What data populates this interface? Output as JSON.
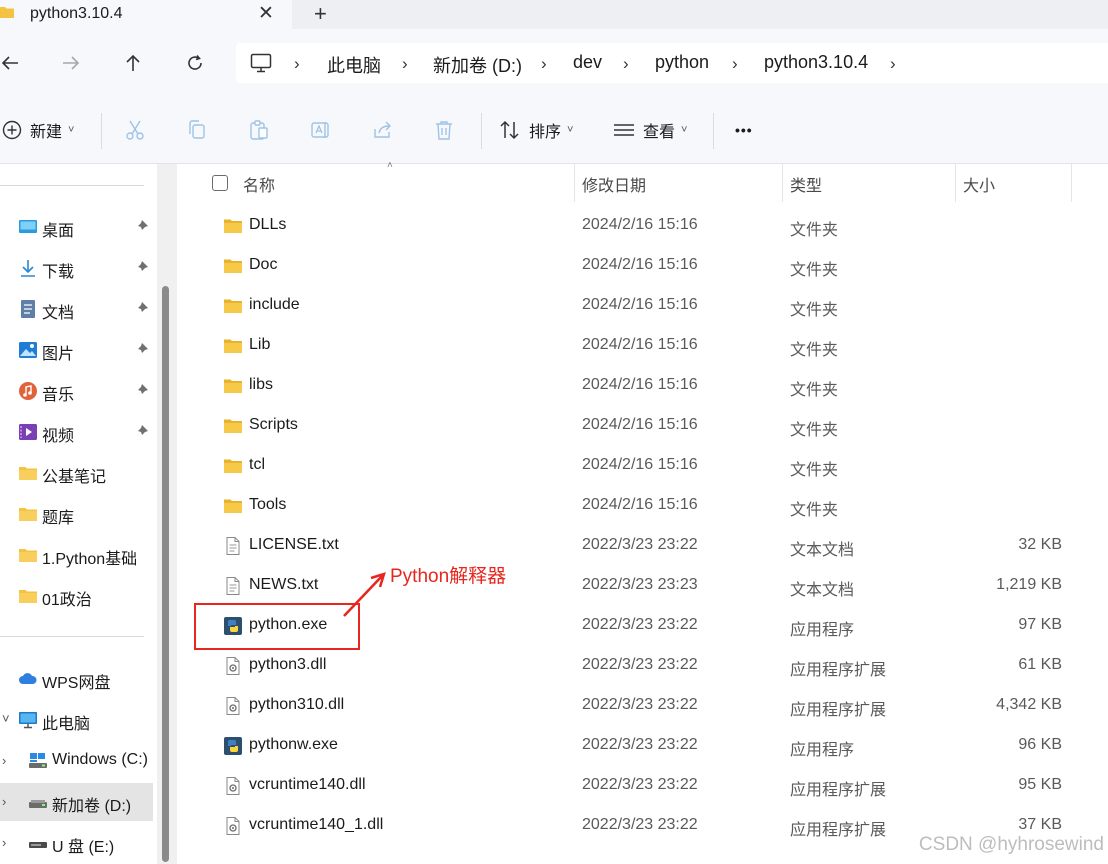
{
  "tab": {
    "title": "python3.10.4",
    "close_glyph": "✕",
    "new_glyph": "+"
  },
  "address": {
    "root_icon": "computer-icon",
    "crumbs": [
      "此电脑",
      "新加卷 (D:)",
      "dev",
      "python",
      "python3.10.4"
    ]
  },
  "toolbar": {
    "new_label": "新建",
    "sort_label": "排序",
    "view_label": "查看",
    "more_label": "•••"
  },
  "sidebar": {
    "quick_access": [
      {
        "label": "桌面",
        "icon": "desktop-icon",
        "pinned": true
      },
      {
        "label": "下载",
        "icon": "download-icon",
        "pinned": true
      },
      {
        "label": "文档",
        "icon": "documents-icon",
        "pinned": true
      },
      {
        "label": "图片",
        "icon": "pictures-icon",
        "pinned": true
      },
      {
        "label": "音乐",
        "icon": "music-icon",
        "pinned": true
      },
      {
        "label": "视频",
        "icon": "videos-icon",
        "pinned": true
      },
      {
        "label": "公基笔记",
        "icon": "folder-icon",
        "pinned": false
      },
      {
        "label": "题库",
        "icon": "folder-icon",
        "pinned": false
      },
      {
        "label": "1.Python基础",
        "icon": "folder-icon",
        "pinned": false
      },
      {
        "label": "01政治",
        "icon": "folder-icon",
        "pinned": false
      }
    ],
    "locations": [
      {
        "label": "WPS网盘",
        "icon": "cloud-icon"
      },
      {
        "label": "此电脑",
        "icon": "computer-icon"
      },
      {
        "label": "Windows (C:)",
        "icon": "windows-drive-icon"
      },
      {
        "label": "新加卷 (D:)",
        "icon": "drive-icon",
        "selected": true
      },
      {
        "label": "U 盘 (E:)",
        "icon": "usb-drive-icon"
      }
    ]
  },
  "columns": {
    "name": "名称",
    "date": "修改日期",
    "type": "类型",
    "size": "大小"
  },
  "files": [
    {
      "name": "DLLs",
      "date": "2024/2/16 15:16",
      "type": "文件夹",
      "size": "",
      "icon": "folder"
    },
    {
      "name": "Doc",
      "date": "2024/2/16 15:16",
      "type": "文件夹",
      "size": "",
      "icon": "folder"
    },
    {
      "name": "include",
      "date": "2024/2/16 15:16",
      "type": "文件夹",
      "size": "",
      "icon": "folder"
    },
    {
      "name": "Lib",
      "date": "2024/2/16 15:16",
      "type": "文件夹",
      "size": "",
      "icon": "folder"
    },
    {
      "name": "libs",
      "date": "2024/2/16 15:16",
      "type": "文件夹",
      "size": "",
      "icon": "folder"
    },
    {
      "name": "Scripts",
      "date": "2024/2/16 15:16",
      "type": "文件夹",
      "size": "",
      "icon": "folder"
    },
    {
      "name": "tcl",
      "date": "2024/2/16 15:16",
      "type": "文件夹",
      "size": "",
      "icon": "folder"
    },
    {
      "name": "Tools",
      "date": "2024/2/16 15:16",
      "type": "文件夹",
      "size": "",
      "icon": "folder"
    },
    {
      "name": "LICENSE.txt",
      "date": "2022/3/23 23:22",
      "type": "文本文档",
      "size": "32 KB",
      "icon": "text"
    },
    {
      "name": "NEWS.txt",
      "date": "2022/3/23 23:23",
      "type": "文本文档",
      "size": "1,219 KB",
      "icon": "text"
    },
    {
      "name": "python.exe",
      "date": "2022/3/23 23:22",
      "type": "应用程序",
      "size": "97 KB",
      "icon": "python"
    },
    {
      "name": "python3.dll",
      "date": "2022/3/23 23:22",
      "type": "应用程序扩展",
      "size": "61 KB",
      "icon": "dll"
    },
    {
      "name": "python310.dll",
      "date": "2022/3/23 23:22",
      "type": "应用程序扩展",
      "size": "4,342 KB",
      "icon": "dll"
    },
    {
      "name": "pythonw.exe",
      "date": "2022/3/23 23:22",
      "type": "应用程序",
      "size": "96 KB",
      "icon": "python"
    },
    {
      "name": "vcruntime140.dll",
      "date": "2022/3/23 23:22",
      "type": "应用程序扩展",
      "size": "95 KB",
      "icon": "dll"
    },
    {
      "name": "vcruntime140_1.dll",
      "date": "2022/3/23 23:22",
      "type": "应用程序扩展",
      "size": "37 KB",
      "icon": "dll"
    }
  ],
  "annotation": {
    "text": "Python解释器",
    "color": "#e8261d"
  },
  "watermark": "CSDN @hyhrosewind",
  "colors": {
    "folder": "#f5c342",
    "accent": "#0067c0",
    "annotation": "#e8261d"
  }
}
